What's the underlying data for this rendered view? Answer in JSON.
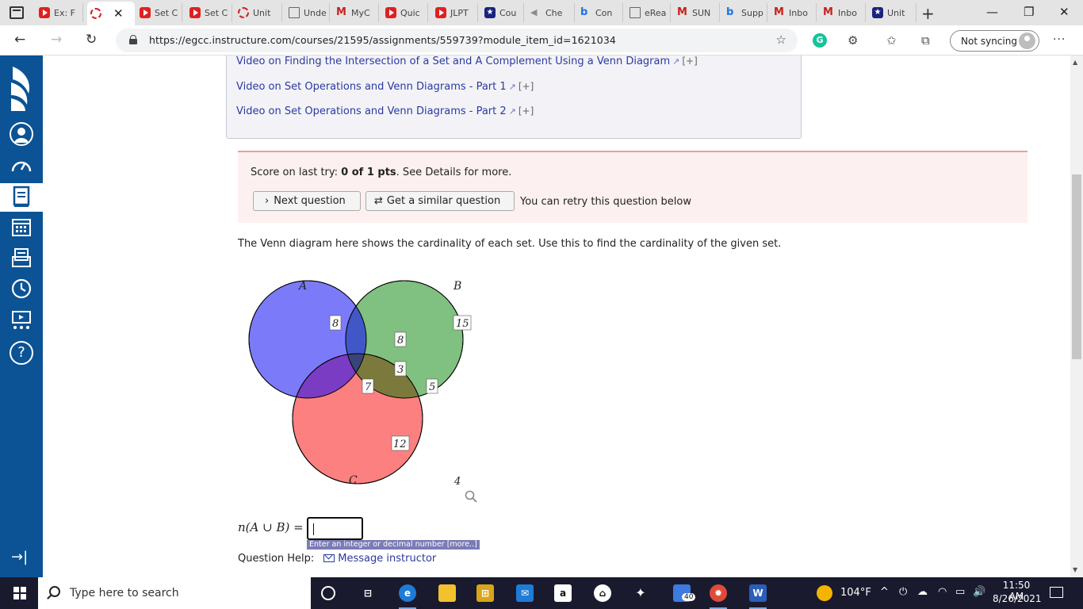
{
  "browser": {
    "tabs": [
      {
        "label": "Ex: F",
        "icon": "youtube-icon"
      },
      {
        "label": "",
        "icon": "ring-icon",
        "active": true
      },
      {
        "label": "Set C",
        "icon": "youtube-icon"
      },
      {
        "label": "Set C",
        "icon": "youtube-icon"
      },
      {
        "label": "Unit",
        "icon": "ring-icon"
      },
      {
        "label": "Unde",
        "icon": "doc-icon"
      },
      {
        "label": "MyC",
        "icon": "gmail-icon"
      },
      {
        "label": "Quic",
        "icon": "youtube-icon"
      },
      {
        "label": "JLPT",
        "icon": "youtube-icon"
      },
      {
        "label": "Cou",
        "icon": "star-icon"
      },
      {
        "label": "Che",
        "icon": "bird-icon"
      },
      {
        "label": "Con",
        "icon": "bing-icon"
      },
      {
        "label": "eRea",
        "icon": "doc-icon"
      },
      {
        "label": "SUN",
        "icon": "gmail-icon"
      },
      {
        "label": "Supp",
        "icon": "bing-icon"
      },
      {
        "label": "Inbo",
        "icon": "gmail-icon"
      },
      {
        "label": "Inbo",
        "icon": "gmail-icon"
      },
      {
        "label": "Unit",
        "icon": "star-icon"
      }
    ],
    "url": "https://egcc.instructure.com/courses/21595/assignments/559739?module_item_id=1621034",
    "sync_label": "Not syncing"
  },
  "videos": [
    "Video on Finding the Intersection of a Set and A Complement Using a Venn Diagram",
    "Video on Set Operations and Venn Diagrams - Part 1",
    "Video on Set Operations and Venn Diagrams - Part 2"
  ],
  "video_suffix": "[+]",
  "score": {
    "prefix": "Score on last try: ",
    "value": "0 of 1 pts",
    "suffix": ". See Details for more.",
    "next_label": "Next question",
    "similar_label": "Get a similar question",
    "retry_note": "You can retry this question below"
  },
  "question_text": "The Venn diagram here shows the cardinality of each set. Use this to find the cardinality of the given set.",
  "venn": {
    "labels": {
      "A": "A",
      "B": "B",
      "C": "C"
    },
    "regions": {
      "a_only": "8",
      "b_only": "15",
      "ab_only": "8",
      "abc": "3",
      "ac_only": "7",
      "bc_only": "5",
      "c_only": "12",
      "outside": "4"
    },
    "colors": {
      "A": "#7b7bfa",
      "B": "#80c080",
      "C": "#fd8080"
    }
  },
  "answer": {
    "label": "n(A ∪ B) =",
    "hint": "Enter an integer or decimal number [more..]"
  },
  "help": {
    "label": "Question Help:",
    "link": "Message instructor"
  },
  "taskbar": {
    "search_placeholder": "Type here to search",
    "temperature": "104°F",
    "time": "11:50 AM",
    "date": "8/26/2021",
    "badge": "40"
  }
}
